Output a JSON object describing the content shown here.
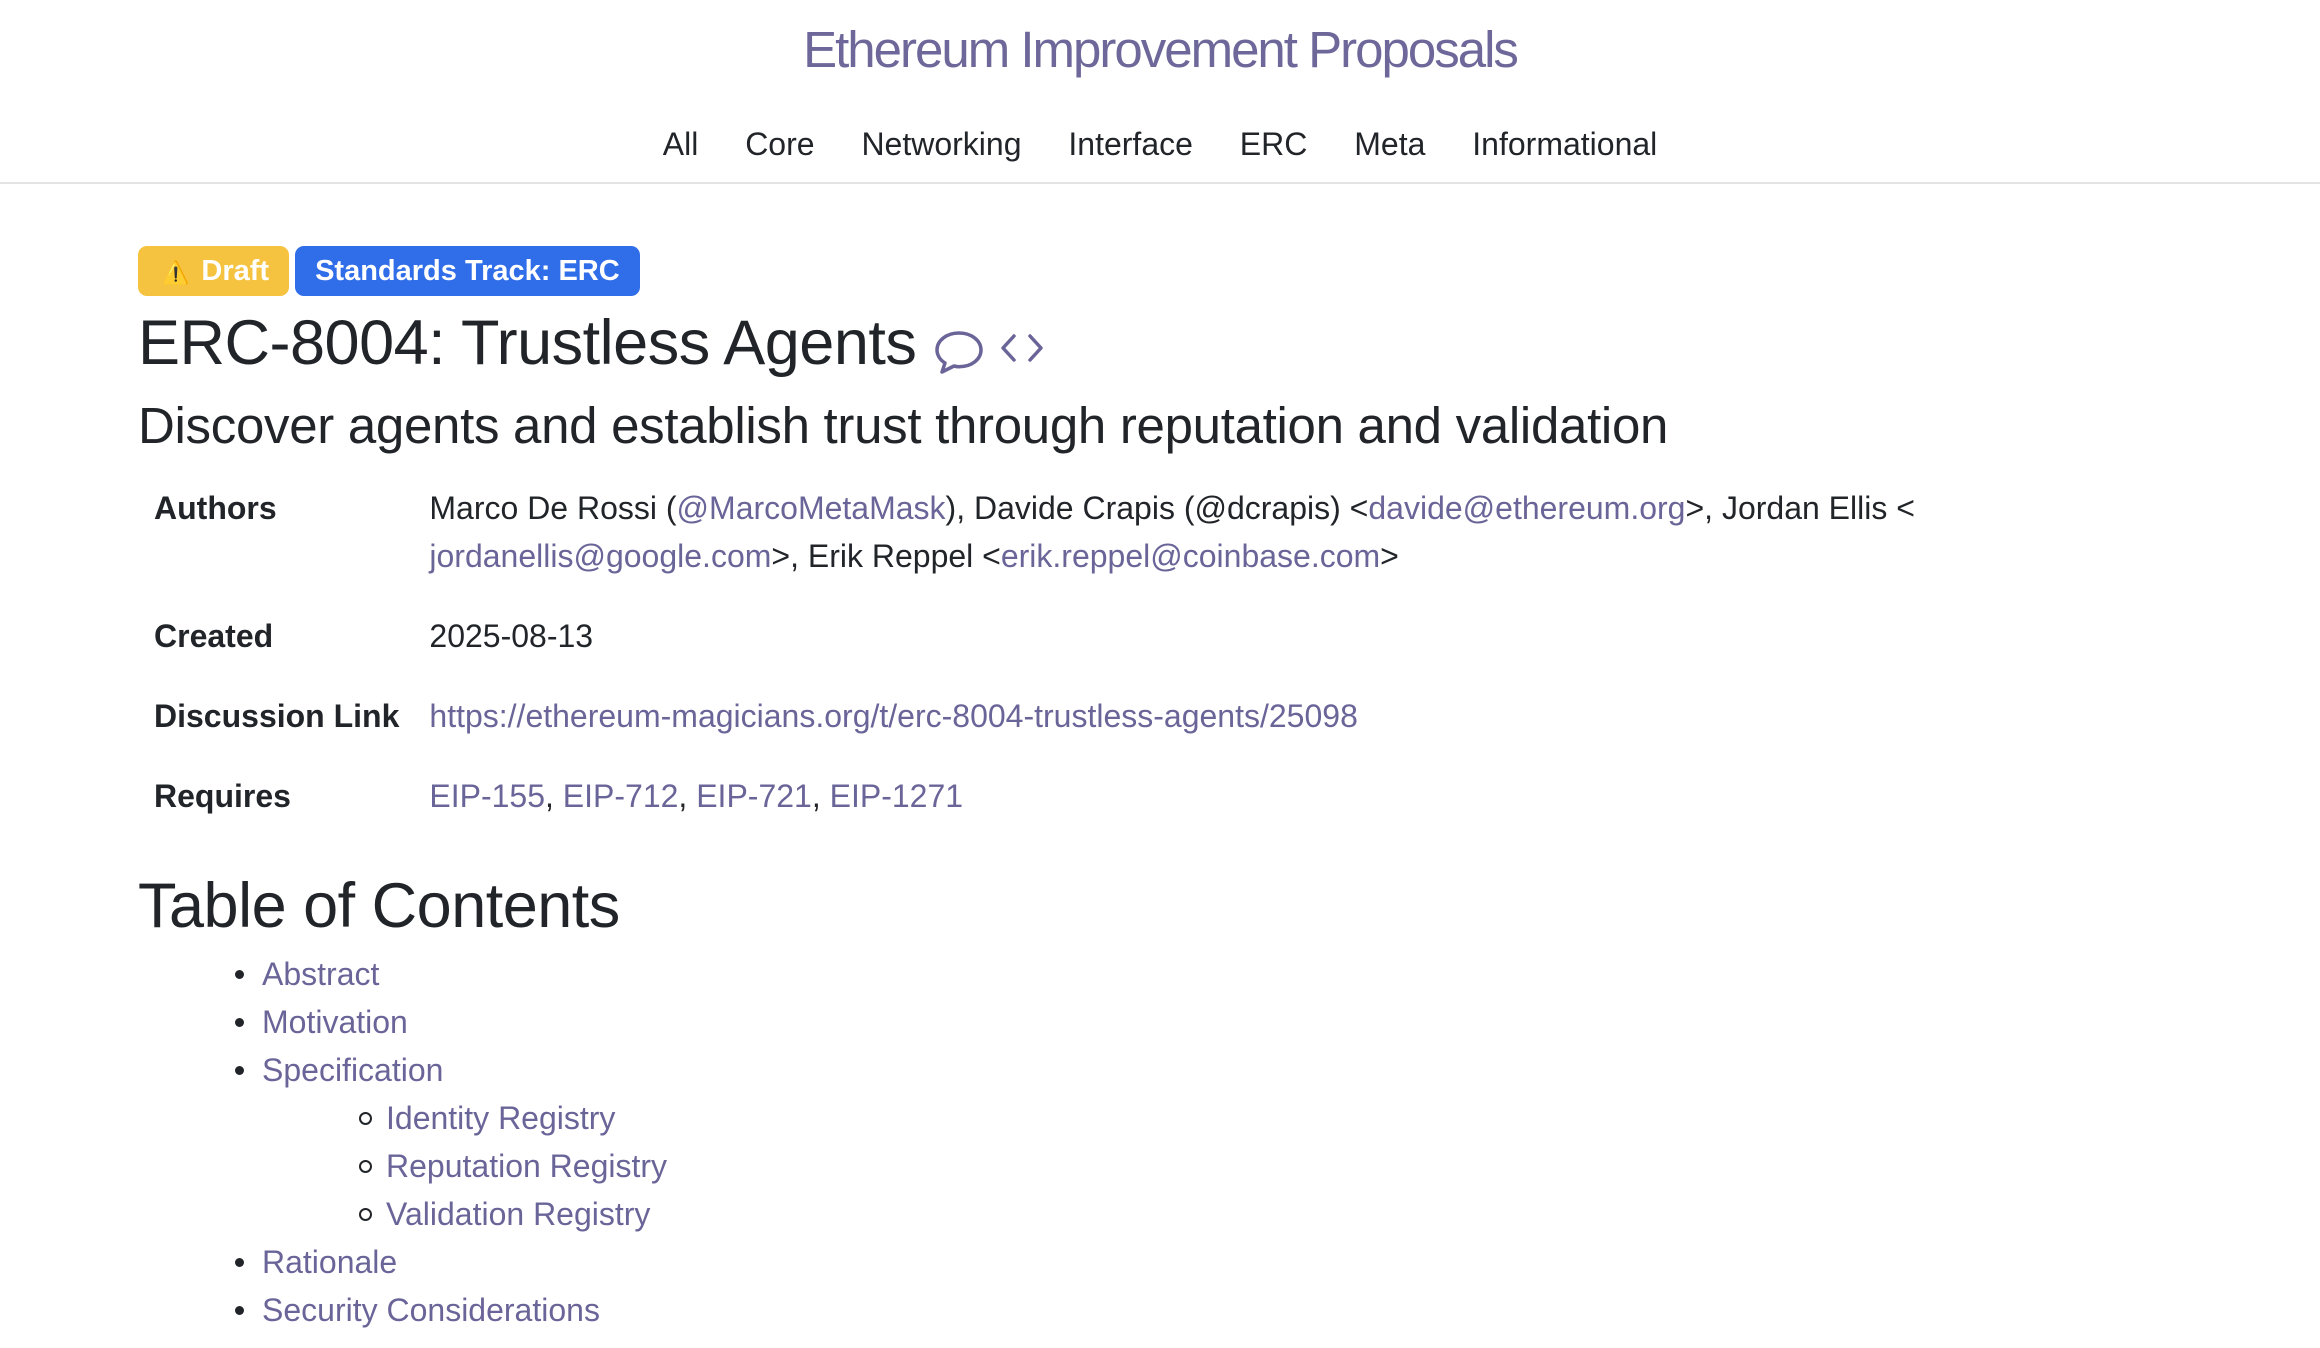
{
  "site": {
    "title": "Ethereum Improvement Proposals"
  },
  "nav": {
    "items": [
      "All",
      "Core",
      "Networking",
      "Interface",
      "ERC",
      "Meta",
      "Informational"
    ]
  },
  "badges": {
    "draft_icon": "⚠️",
    "draft": "Draft",
    "track": "Standards Track: ERC",
    "colors": {
      "draft": "#f5c33f",
      "track": "#2f6de9"
    }
  },
  "eip": {
    "title": "ERC-8004: Trustless Agents",
    "icons": [
      "comment-icon",
      "code-icon"
    ],
    "description": "Discover agents and establish trust through reputation and validation"
  },
  "preamble": {
    "authors_label": "Authors",
    "authors": {
      "a1_pre": "Marco De Rossi (",
      "a1_handle": "@MarcoMetaMask",
      "a1_post": "), Davide Crapis (@dcrapis) <",
      "a2_email": "davide@ethereum.org",
      "a2_post": ">, Jordan Ellis <",
      "a3_email": "jordanellis@google.com",
      "a3_post": ">, Erik Reppel <",
      "a4_email": "erik.reppel@coinbase.com",
      "a4_post": ">"
    },
    "created_label": "Created",
    "created": "2025-08-13",
    "discussion_label": "Discussion Link",
    "discussion": "https://ethereum-magicians.org/t/erc-8004-trustless-agents/25098",
    "requires_label": "Requires",
    "requires": [
      "EIP-155",
      "EIP-712",
      "EIP-721",
      "EIP-1271"
    ],
    "separator": ", "
  },
  "toc": {
    "heading": "Table of Contents",
    "items": [
      "Abstract",
      "Motivation",
      "Specification",
      "Rationale",
      "Security Considerations"
    ],
    "spec_children": [
      "Identity Registry",
      "Reputation Registry",
      "Validation Registry"
    ]
  },
  "colors": {
    "link": "#6a6598",
    "text": "#212529"
  }
}
